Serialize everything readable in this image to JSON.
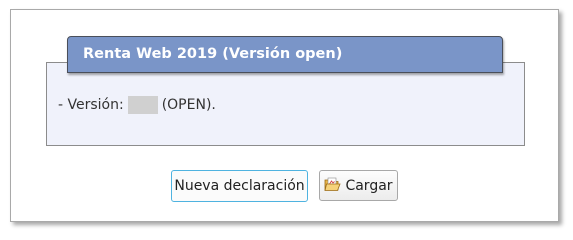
{
  "panel": {
    "title": "Renta Web 2019 (Versión open)",
    "version_prefix": "- Versión:",
    "version_suffix": "(OPEN)."
  },
  "buttons": {
    "new_label": "Nueva declaración",
    "load_label": "Cargar",
    "load_icon": "folder-open-icon"
  },
  "colors": {
    "header_bg": "#7a95c8",
    "panel_bg": "#f0f2fb",
    "focus_border": "#4fb3e0"
  }
}
